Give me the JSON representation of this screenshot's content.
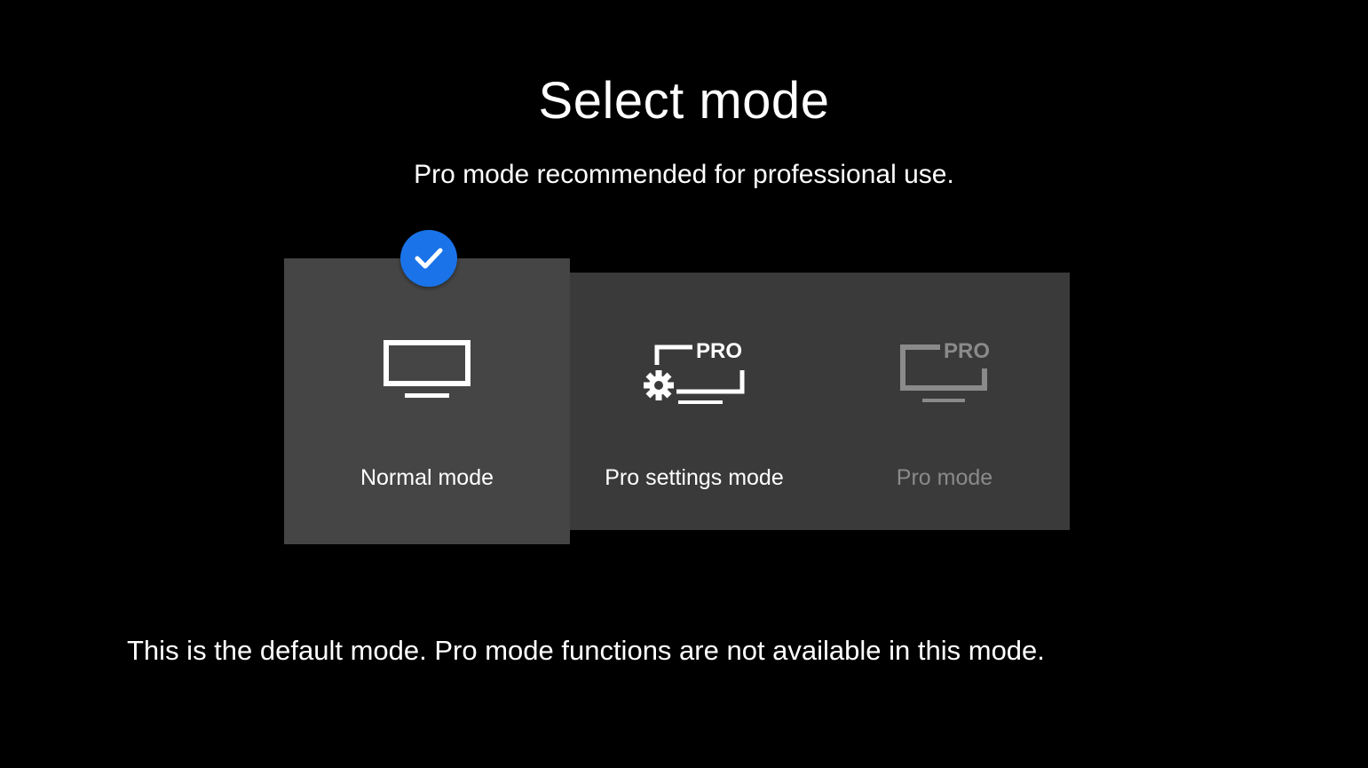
{
  "header": {
    "title": "Select mode",
    "subtitle": "Pro mode recommended for professional use."
  },
  "modes": [
    {
      "id": "normal",
      "label": "Normal mode",
      "icon": "tv-icon",
      "selected": true
    },
    {
      "id": "pro-settings",
      "label": "Pro settings mode",
      "icon": "pro-settings-icon",
      "badge": "PRO",
      "selected": false
    },
    {
      "id": "pro",
      "label": "Pro mode",
      "icon": "pro-tv-icon",
      "badge": "PRO",
      "selected": false,
      "disabled": true
    }
  ],
  "description": "This is the default mode. Pro mode functions are not available in this mode.",
  "colors": {
    "background": "#000000",
    "selected_tile": "#454545",
    "tile": "#3a3a3a",
    "accent": "#1a73e8",
    "disabled_text": "#8a8a8a"
  }
}
